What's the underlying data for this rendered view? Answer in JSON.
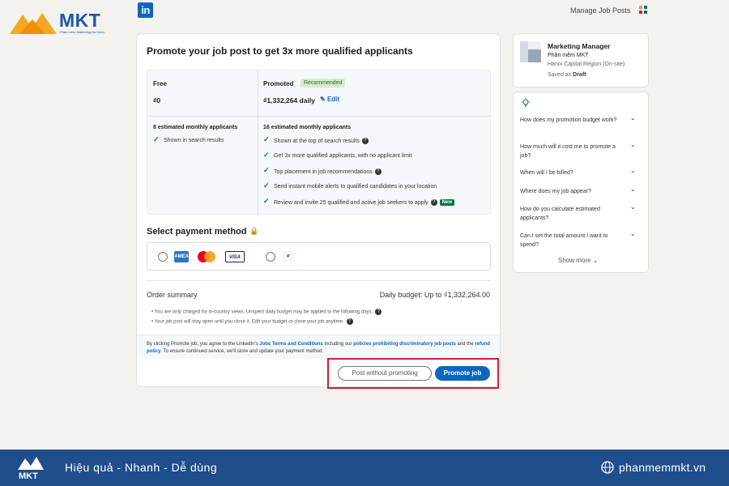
{
  "brand": {
    "name": "MKT",
    "tagline": "Phần mềm Marketing Đa Kênh"
  },
  "header": {
    "linkedin_logo": "in",
    "manage_job_posts": "Manage Job Posts"
  },
  "promo": {
    "title": "Promote your job post to get 3x more qualified applicants",
    "free": {
      "name": "Free",
      "price": "₫0",
      "applicants": "8 estimated monthly applicants",
      "features": [
        "Shown in search results"
      ]
    },
    "promoted": {
      "name": "Promoted",
      "badge": "Recommended",
      "price": "₫1,332,264 daily",
      "edit": "Edit",
      "applicants": "16 estimated monthly applicants",
      "features": [
        "Shown at the top of search results",
        "Get 3x more qualified applicants, with no applicant limit",
        "Top placement in job recommendations",
        "Send instant mobile alerts to qualified candidates in your location",
        "Review and invite 25 qualified and active job seekers to apply"
      ],
      "new_badge": "New"
    }
  },
  "payment": {
    "title": "Select payment method",
    "cards": [
      "AMEX",
      "mastercard",
      "VISA"
    ],
    "paypal": "PayPal"
  },
  "order": {
    "label": "Order summary",
    "budget": "Daily budget: Up to ₫1,332,264.00",
    "notes": [
      "You are only charged for in-country views. Unspent daily budget may be applied to the following days.",
      "Your job post will stay open until you close it. Edit your budget or close your job anytime."
    ]
  },
  "terms": {
    "t1": "By clicking Promote job, you agree to the LinkedIn's ",
    "link1": "Jobs Terms and Conditions",
    "t2": " including our ",
    "link2": "policies prohibiting discriminatory job posts",
    "t3": " and the ",
    "link3": "refund policy",
    "t4": ". To ensure continued service, we'll store and update your payment method."
  },
  "buttons": {
    "post_without": "Post without promoting",
    "promote": "Promote job"
  },
  "job": {
    "title": "Marketing Manager",
    "company": "Phần mềm MKT",
    "location": "Hanoi Capital Region (On-site)",
    "saved_prefix": "Saved as ",
    "saved_status": "Draft"
  },
  "faq": {
    "items": [
      "How does my promotion budget work?",
      "How much will it cost me to promote a job?",
      "When will I be billed?",
      "Where does my job appear?",
      "How do you calculate estimated applicants?",
      "Can I set the total amount I want to spend?"
    ],
    "show_more": "Show more"
  },
  "footer": {
    "slogan": "Hiệu quả - Nhanh  - Dễ dùng",
    "site": "phanmemmkt.vn"
  },
  "colors": {
    "accent": "#0a66c2",
    "footer": "#1f4e8c",
    "highlight": "#d6202a"
  }
}
